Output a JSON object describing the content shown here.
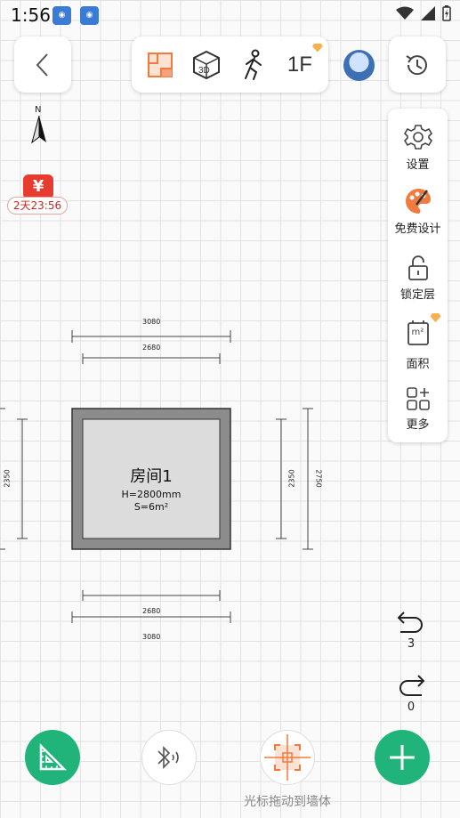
{
  "status_bar": {
    "time": "1:56",
    "app_icons": [
      "app-icon",
      "app-icon"
    ]
  },
  "header": {
    "view_modes": [
      {
        "name": "plan-view-icon",
        "active": true
      },
      {
        "name": "3d-view-icon",
        "label": "3D"
      },
      {
        "name": "walk-view-icon"
      },
      {
        "name": "floor-selector",
        "label": "1F",
        "premium": true
      }
    ]
  },
  "compass": {
    "label": "N"
  },
  "promo": {
    "badge": "¥",
    "timer": "2天23:56"
  },
  "right_tools": [
    {
      "icon": "gear-icon",
      "label": "设置"
    },
    {
      "icon": "palette-icon",
      "label": "免费设计"
    },
    {
      "icon": "unlock-icon",
      "label": "锁定层"
    },
    {
      "icon": "area-icon",
      "label": "面积",
      "icon_text": "m²",
      "premium": true
    },
    {
      "icon": "grid-plus-icon",
      "label": "更多"
    }
  ],
  "plan": {
    "room": {
      "name": "房间1",
      "height": "H=2800mm",
      "area": "S=6m²"
    },
    "dimensions": {
      "top_outer": "3080",
      "top_inner": "2680",
      "bottom_inner": "2680",
      "bottom_outer": "3080",
      "left": "2350",
      "right_inner": "2350",
      "right_outer": "2750"
    }
  },
  "undo": {
    "count": "3"
  },
  "redo": {
    "count": "0"
  },
  "bottom": {
    "cursor_hint": "光标拖动到墙体"
  },
  "colors": {
    "accent_green": "#21b47a",
    "accent_orange": "#f07b3f",
    "wall_gray": "#8c8c8c",
    "room_fill": "#dcdcdc"
  }
}
